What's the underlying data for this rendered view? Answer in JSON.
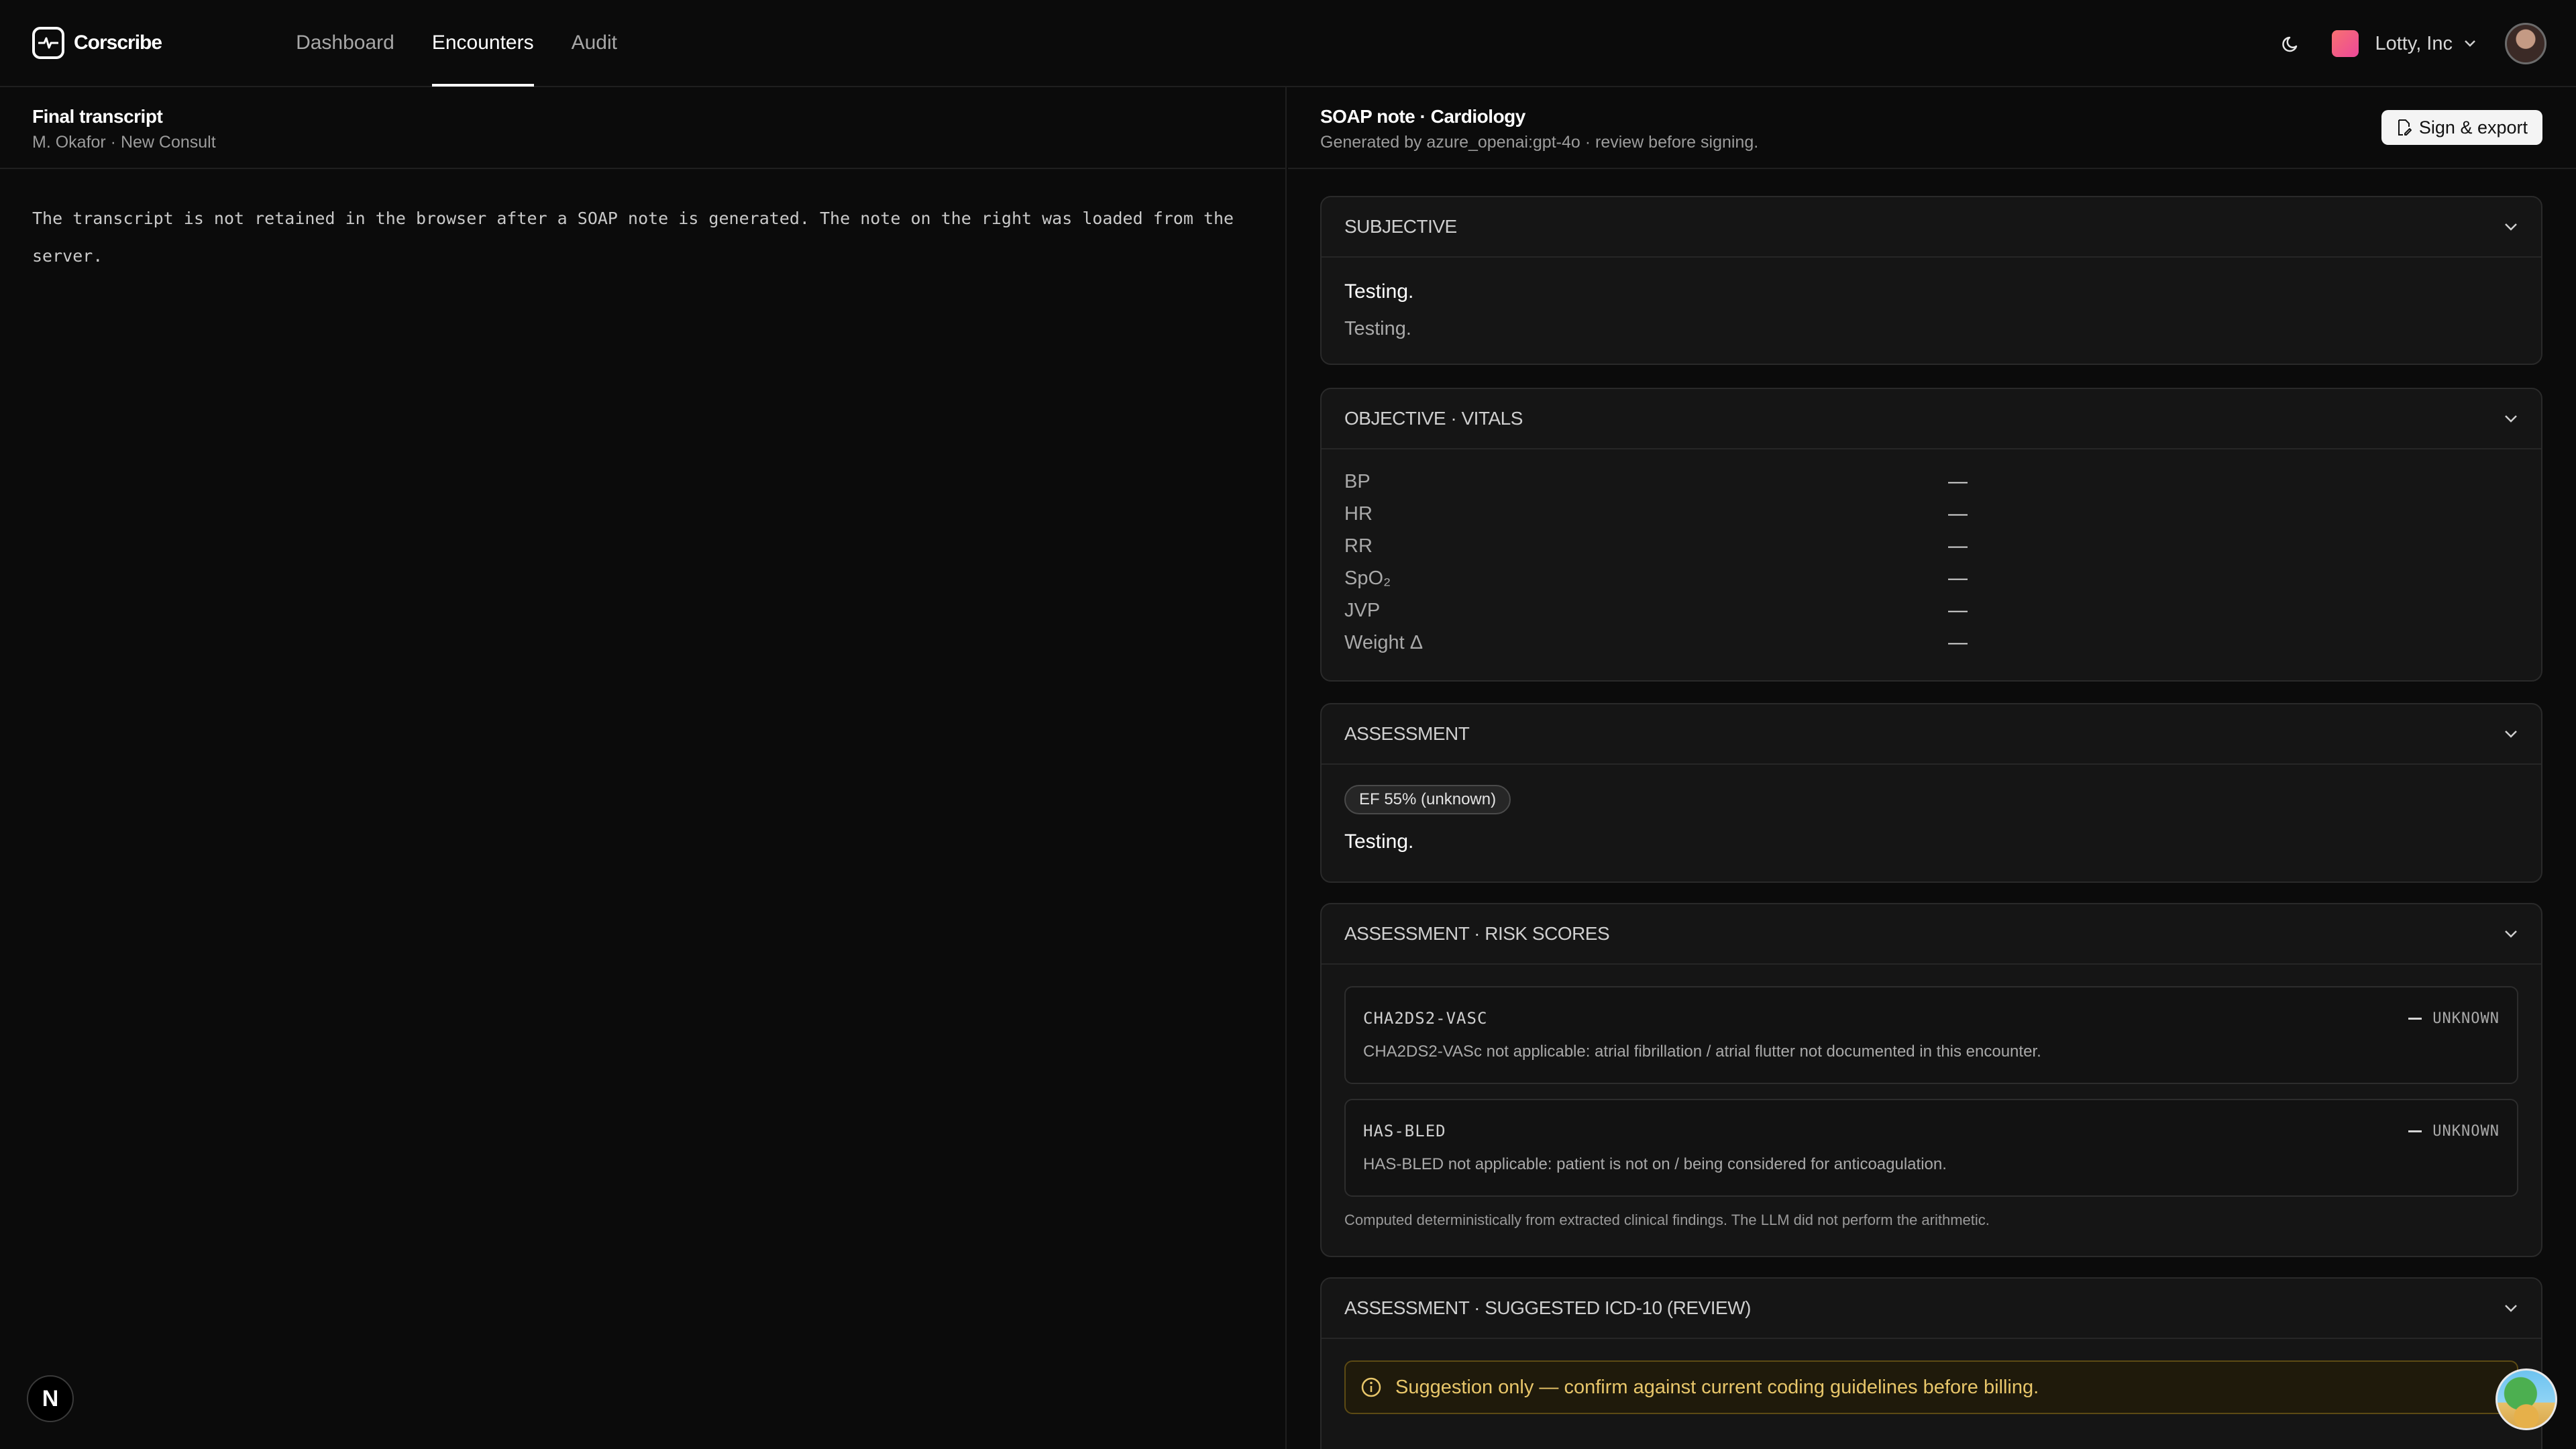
{
  "app": {
    "name": "Corscribe",
    "nav": [
      {
        "label": "Dashboard",
        "active": false
      },
      {
        "label": "Encounters",
        "active": true
      },
      {
        "label": "Audit",
        "active": false
      }
    ],
    "org_name": "Lotty, Inc",
    "icons": {
      "theme_toggle": "moon-icon",
      "logo": "pulse-logo-icon",
      "org": "org-badge",
      "user": "avatar"
    }
  },
  "transcript_pane": {
    "title": "Final transcript",
    "subtitle": "M. Okafor · New Consult",
    "body": "The transcript is not retained in the browser after a SOAP note is generated. The note on the right was loaded from the server."
  },
  "soap_pane": {
    "title": "SOAP note · Cardiology",
    "subtitle": "Generated by azure_openai:gpt-4o · review before signing.",
    "sign_button": "Sign & export",
    "subjective": {
      "heading": "SUBJECTIVE",
      "line1": "Testing.",
      "line2": "Testing."
    },
    "objective": {
      "heading": "OBJECTIVE · VITALS",
      "vitals": [
        {
          "name": "BP",
          "value": "—"
        },
        {
          "name": "HR",
          "value": "—"
        },
        {
          "name": "RR",
          "value": "—"
        },
        {
          "name": "SpO₂",
          "value": "—"
        },
        {
          "name": "JVP",
          "value": "—"
        },
        {
          "name": "Weight Δ",
          "value": "—"
        }
      ]
    },
    "assessment": {
      "heading": "ASSESSMENT",
      "pill": "EF 55% (unknown)",
      "text": "Testing."
    },
    "risk_scores": {
      "heading": "ASSESSMENT · RISK SCORES",
      "items": [
        {
          "name": "CHA2DS2-VASC",
          "status": "UNKNOWN",
          "description": "CHA2DS2-VASc not applicable: atrial fibrillation / atrial flutter not documented in this encounter."
        },
        {
          "name": "HAS-BLED",
          "status": "UNKNOWN",
          "description": "HAS-BLED not applicable: patient is not on / being considered for anticoagulation."
        }
      ],
      "footnote": "Computed deterministically from extracted clinical findings. The LLM did not perform the arithmetic."
    },
    "icd": {
      "heading": "ASSESSMENT · SUGGESTED ICD-10 (REVIEW)",
      "warning": "Suggestion only — confirm against current coding guidelines before billing."
    }
  },
  "floating": {
    "dev_badge": "N"
  },
  "colors": {
    "background": "#0b0b0b",
    "card": "#151515",
    "warning": "#e8c66a"
  }
}
